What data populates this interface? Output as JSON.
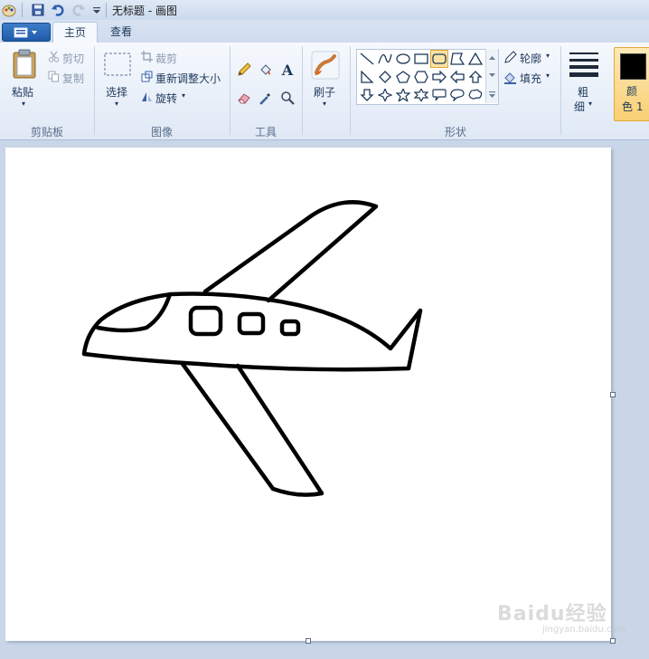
{
  "window": {
    "title": "无标题 - 画图"
  },
  "tabs": [
    {
      "label": "主页",
      "active": true
    },
    {
      "label": "查看",
      "active": false
    }
  ],
  "clipboard": {
    "paste_label": "粘贴",
    "cut_label": "剪切",
    "copy_label": "复制",
    "group_label": "剪贴板"
  },
  "image": {
    "select_label": "选择",
    "crop_label": "裁剪",
    "resize_label": "重新调整大小",
    "rotate_label": "旋转",
    "group_label": "图像"
  },
  "tools": {
    "group_label": "工具"
  },
  "brushes": {
    "label": "刷子"
  },
  "shapes": {
    "group_label": "形状",
    "outline_label": "轮廓",
    "fill_label": "填充"
  },
  "size": {
    "label_line1": "粗",
    "label_line2": "细"
  },
  "colors": {
    "color1_line1": "颜",
    "color1_line2": "色 1",
    "color1_value": "#000000"
  },
  "watermark": {
    "text": "Baidu经验",
    "sub": "jingyan.baidu.com"
  }
}
